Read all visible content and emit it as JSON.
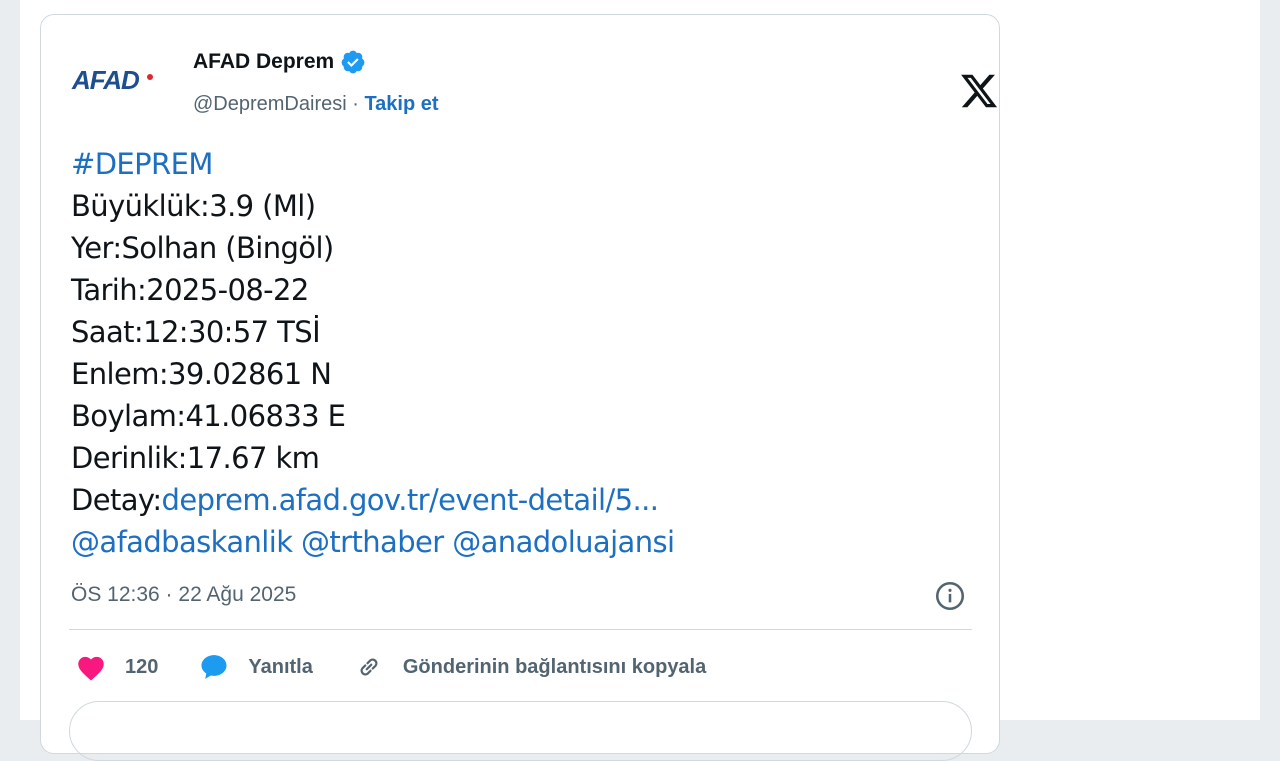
{
  "author": {
    "avatar_text": "AFAD",
    "display_name": "AFAD Deprem",
    "handle": "@DepremDairesi",
    "separator": " · ",
    "follow_label": "Takip et"
  },
  "tweet": {
    "hashtag": "#DEPREM",
    "magnitude": "Büyüklük:3.9 (Ml)",
    "location": "Yer:Solhan (Bingöl)",
    "date": "Tarih:2025-08-22",
    "time": "Saat:12:30:57 TSİ",
    "latitude": "Enlem:39.02861 N",
    "longitude": "Boylam:41.06833 E",
    "depth": "Derinlik:17.67 km",
    "detail_prefix": "Detay:",
    "detail_link": "deprem.afad.gov.tr/event-detail/5...",
    "mentions": "@afadbaskanlik @trthaber @anadoluajansi",
    "timestamp": "ÖS 12:36 · 22 Ağu 2025"
  },
  "actions": {
    "like_count": "120",
    "reply_label": "Yanıtla",
    "copy_link_label": "Gönderinin bağlantısını kopyala"
  },
  "icons": [
    "verified-icon",
    "x-logo-icon",
    "info-icon",
    "heart-icon",
    "reply-bubble-icon",
    "link-icon"
  ],
  "colors": {
    "link_blue": "#1d6fc2",
    "heart": "#f91880",
    "verified": "#1d9bf0",
    "text": "#0f1419",
    "muted": "#536471"
  }
}
